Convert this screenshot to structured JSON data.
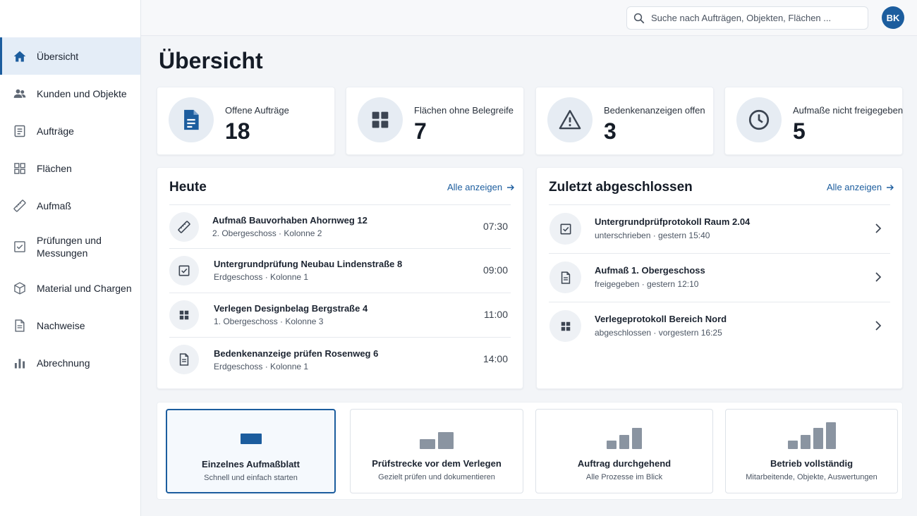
{
  "sidebar": {
    "items": [
      {
        "label": "Übersicht",
        "icon": "home-icon"
      },
      {
        "label": "Kunden und Objekte",
        "icon": "users-icon"
      },
      {
        "label": "Aufträge",
        "icon": "document-list-icon"
      },
      {
        "label": "Flächen",
        "icon": "grid-icon"
      },
      {
        "label": "Aufmaß",
        "icon": "ruler-icon"
      },
      {
        "label": "Prüfungen und Messungen",
        "icon": "checkbox-icon"
      },
      {
        "label": "Material und Chargen",
        "icon": "box-icon"
      },
      {
        "label": "Nachweise",
        "icon": "document-icon"
      },
      {
        "label": "Abrechnung",
        "icon": "bar-chart-icon"
      }
    ]
  },
  "header": {
    "search_placeholder": "Suche nach Aufträgen, Objekten, Flächen ...",
    "avatar_initials": "BK"
  },
  "page": {
    "title": "Übersicht"
  },
  "stats": [
    {
      "label": "Offene Aufträge",
      "value": "18",
      "icon": "document-icon"
    },
    {
      "label": "Flächen ohne Belegreife",
      "value": "7",
      "icon": "grid-icon"
    },
    {
      "label": "Bedenkenanzeigen offen",
      "value": "3",
      "icon": "warning-icon"
    },
    {
      "label": "Aufmaße nicht freigegeben",
      "value": "5",
      "icon": "clock-icon"
    }
  ],
  "today": {
    "title": "Heute",
    "link": "Alle anzeigen",
    "items": [
      {
        "title": "Aufmaß Bauvorhaben Ahornweg 12",
        "sub": "2. Obergeschoss · Kolonne 2",
        "time": "07:30",
        "icon": "ruler-icon"
      },
      {
        "title": "Untergrundprüfung Neubau Lindenstraße 8",
        "sub": "Erdgeschoss · Kolonne 1",
        "time": "09:00",
        "icon": "checkbox-icon"
      },
      {
        "title": "Verlegen Designbelag Bergstraße 4",
        "sub": "1. Obergeschoss · Kolonne 3",
        "time": "11:00",
        "icon": "grid-icon"
      },
      {
        "title": "Bedenkenanzeige prüfen Rosenweg 6",
        "sub": "Erdgeschoss · Kolonne 1",
        "time": "14:00",
        "icon": "document-icon"
      }
    ]
  },
  "recent": {
    "title": "Zuletzt abgeschlossen",
    "link": "Alle anzeigen",
    "items": [
      {
        "title": "Untergrundprüfprotokoll Raum 2.04",
        "sub": "unterschrieben · gestern 15:40",
        "icon": "checkbox-icon"
      },
      {
        "title": "Aufmaß 1. Obergeschoss",
        "sub": "freigegeben · gestern 12:10",
        "icon": "document-icon"
      },
      {
        "title": "Verlegeprotokoll Bereich Nord",
        "sub": "abgeschlossen · vorgestern 16:25",
        "icon": "grid-icon"
      }
    ]
  },
  "plans": [
    {
      "title": "Einzelnes Aufmaßblatt",
      "sub": "Schnell und einfach starten",
      "selected": true
    },
    {
      "title": "Prüfstrecke vor dem Verlegen",
      "sub": "Gezielt prüfen und dokumentieren",
      "selected": false
    },
    {
      "title": "Auftrag durchgehend",
      "sub": "Alle Prozesse im Blick",
      "selected": false
    },
    {
      "title": "Betrieb vollständig",
      "sub": "Mitarbeitende, Objekte, Auswertungen",
      "selected": false
    }
  ],
  "colors": {
    "accent": "#1c5d9e",
    "active_nav_bg": "#e4edf7",
    "icon_gray": "#5f6874"
  }
}
